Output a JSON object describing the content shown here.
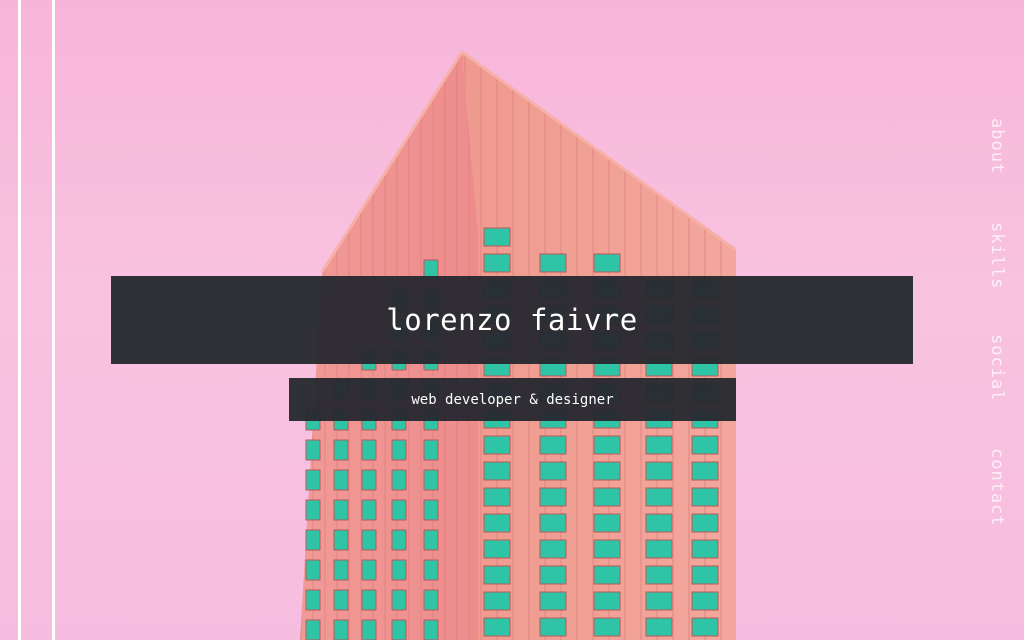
{
  "hero": {
    "name": "lorenzo faivre",
    "tagline": "web developer & designer"
  },
  "nav": {
    "items": [
      {
        "label": "about"
      },
      {
        "label": "skills"
      },
      {
        "label": "social"
      },
      {
        "label": "contact"
      }
    ]
  },
  "colors": {
    "background": "#f8bddf",
    "building": "#ec8f8f",
    "windows": "#2fc4a6",
    "bar": "#282a30",
    "text": "#ffffff"
  }
}
